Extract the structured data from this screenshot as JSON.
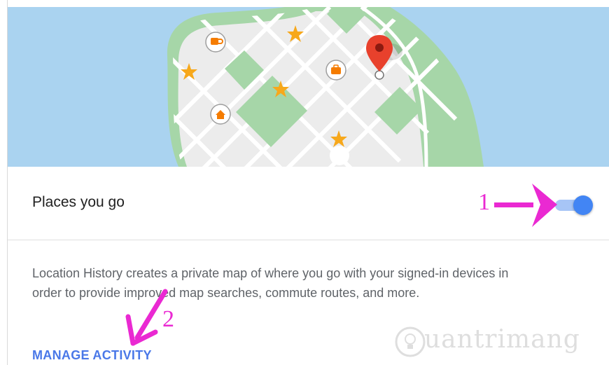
{
  "map": {
    "pin_color": "#e8412c",
    "poi_icons": [
      "coffee-icon",
      "briefcase-icon",
      "home-icon"
    ],
    "favorite_icon": "star-icon",
    "star_color": "#f7a81b"
  },
  "setting": {
    "label": "Places you go",
    "enabled": true,
    "accent": "#4285f4"
  },
  "description": "Location History creates a private map of where you go with your signed-in devices in order to provide improved map searches, commute routes, and more.",
  "manage_link": "MANAGE ACTIVITY",
  "annotations": {
    "step1": "1",
    "step2": "2",
    "color": "#ea29d2"
  },
  "watermark": "uantrimang"
}
